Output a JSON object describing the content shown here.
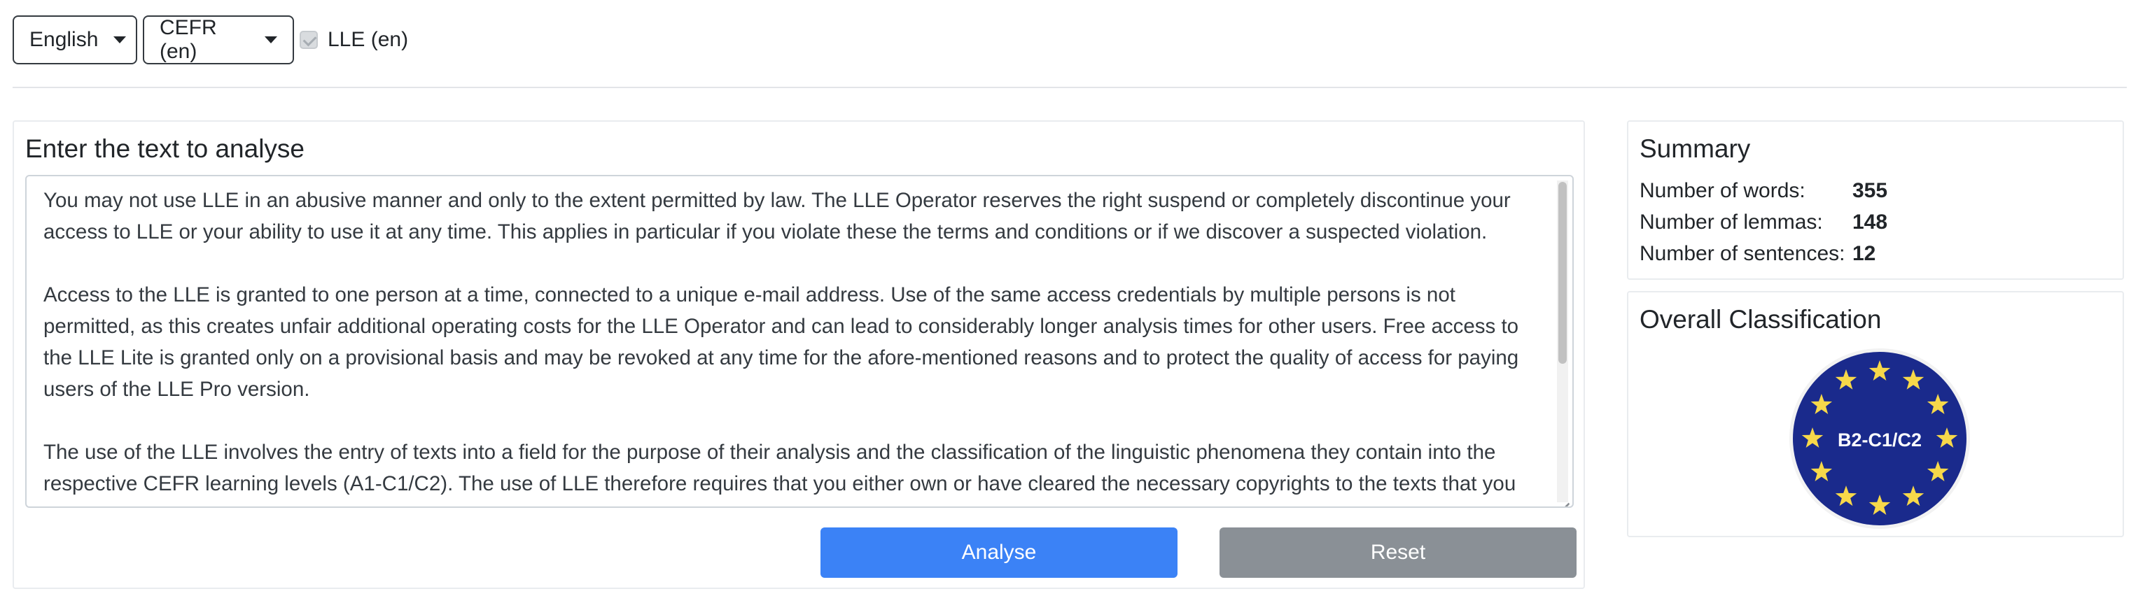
{
  "toolbar": {
    "language": "English",
    "framework": "CEFR (en)",
    "lle_label": "LLE (en)"
  },
  "editor": {
    "title": "Enter the text to analyse",
    "paragraphs": [
      "You may not use LLE in an abusive manner and only to the extent permitted by law. The LLE Operator reserves the right suspend or completely discontinue your access to LLE or your ability to use it at any time. This applies in particular if you violate these the terms and conditions or if we discover a suspected violation.",
      "Access to the LLE is granted to one person at a time, connected to a unique e-mail address. Use of the same access credentials by multiple persons is not permitted, as this creates unfair additional operating costs for the LLE Operator and can lead to considerably longer analysis times for other users. Free access to the LLE Lite is granted only on a provisional basis and may be revoked at any time for the afore-mentioned reasons and to protect the quality of access for paying users of the LLE Pro version.",
      "The use of the LLE involves the entry of texts into a field for the purpose of their analysis and the classification of the linguistic phenomena they contain into the respective CEFR learning levels (A1-C1/C2). The use of LLE therefore requires that you either own or have cleared the necessary copyrights to the texts that you"
    ],
    "analyse_label": "Analyse",
    "reset_label": "Reset"
  },
  "summary": {
    "title": "Summary",
    "rows": [
      {
        "label": "Number of words:",
        "value": "355"
      },
      {
        "label": "Number of lemmas:",
        "value": "148"
      },
      {
        "label": "Number of sentences:",
        "value": "12"
      }
    ]
  },
  "classification": {
    "title": "Overall Classification",
    "level": "B2-C1/C2",
    "badge_color": "#1a2a8c",
    "star_color": "#f7d84a"
  }
}
